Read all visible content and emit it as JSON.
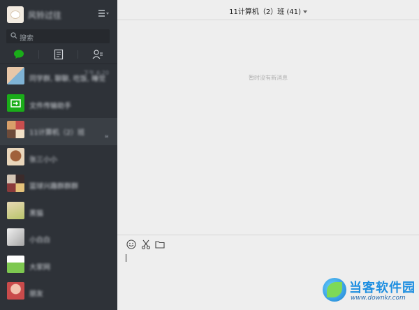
{
  "profile": {
    "nickname": "风铃过往"
  },
  "search": {
    "placeholder": "搜索"
  },
  "chats": [
    {
      "name": "同学群, 聊聊, 吃饭, 睡觉",
      "time": "下午 6:20",
      "mute": "",
      "thumb": "photo-collage"
    },
    {
      "name": "文件传输助手",
      "time": "",
      "mute": "",
      "thumb": "file-transfer"
    },
    {
      "name": "11计算机（2）班",
      "time": "",
      "mute": "≋",
      "thumb": "group-collage"
    },
    {
      "name": "张三小小",
      "time": "",
      "mute": "",
      "thumb": "dog"
    },
    {
      "name": "篮球兴趣群群群",
      "time": "",
      "mute": "",
      "thumb": "group-collage-2"
    },
    {
      "name": "黑猫",
      "time": "",
      "mute": "",
      "thumb": "cartoon"
    },
    {
      "name": "小白白",
      "time": "",
      "mute": "",
      "thumb": "gray-shoe"
    },
    {
      "name": "大家网",
      "time": "",
      "mute": "",
      "thumb": "green-card"
    },
    {
      "name": "朋友",
      "time": "",
      "mute": "",
      "thumb": "people"
    }
  ],
  "main": {
    "title": "11计算机（2）班 (41)",
    "empty_message": "暂时没有新消息"
  },
  "watermark": {
    "title": "当客软件园",
    "url": "www.downkr.com"
  },
  "colors": {
    "sidebar": "#2e3238",
    "active_row": "#3a3f45",
    "accent_green": "#1aad19",
    "main_bg": "#eeeeee"
  }
}
